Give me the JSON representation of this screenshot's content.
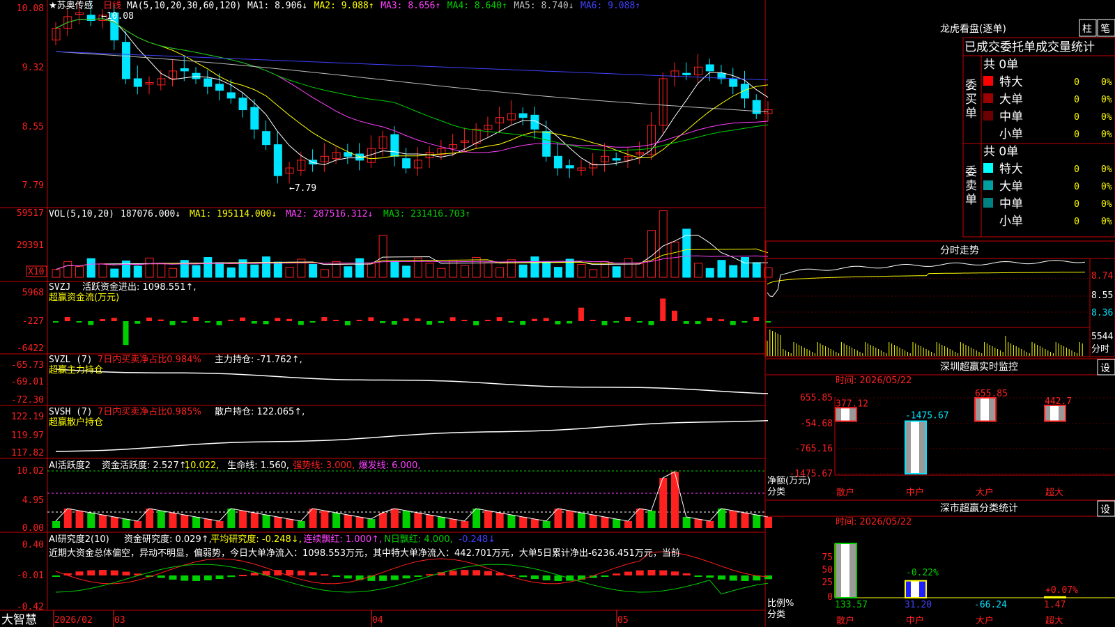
{
  "colors": {
    "up": "#ff2020",
    "down": "#00e5ff",
    "frame": "#c80000",
    "white": "#ffffff",
    "yellow": "#ffff00",
    "magenta": "#ff40ff",
    "green": "#00d000",
    "blue": "#4040ff",
    "gray": "#bdbdbd"
  },
  "stock": {
    "title": "★苏奥传感",
    "period": "日线"
  },
  "kline": {
    "ma_header": "MA(5,10,20,30,60,120)",
    "ma_items": [
      {
        "text": "MA1: 8.906↓",
        "color": "#ffffff"
      },
      {
        "text": "MA2: 9.088↑",
        "color": "#ffff00"
      },
      {
        "text": "MA3: 8.656↑",
        "color": "#ff40ff"
      },
      {
        "text": "MA4: 8.640↑",
        "color": "#00d000"
      },
      {
        "text": "MA5: 8.740↓",
        "color": "#bdbdbd"
      },
      {
        "text": "MA6: 9.088↑",
        "color": "#4040ff"
      }
    ],
    "y_ticks": [
      "10.08",
      "9.32",
      "8.55",
      "7.79"
    ],
    "high_label": "←10.08",
    "low_label": "←7.79"
  },
  "vol": {
    "title": "VOL(5,10,20)",
    "value": "187076.000↓",
    "ma1": "MA1: 195114.000↓",
    "ma2": "MA2: 287516.312↓",
    "ma3": "MA3: 231416.703↑",
    "y_ticks": [
      "59517",
      "29391"
    ],
    "multiplier": "X10"
  },
  "svzj": {
    "title": "SVZJ",
    "label1": "活跃资金进出: 1098.551↑,",
    "label2": "超赢资金流(万元)",
    "y_ticks": [
      "5968",
      "-227",
      "-6422"
    ]
  },
  "svzl": {
    "title": "SVZL (7)",
    "label_red": "7日内买卖净占比0.984%",
    "label_white": "主力持仓: -71.762↑,",
    "label2": "超赢主力持仓",
    "y_ticks": [
      "-65.73",
      "-69.01",
      "-72.30"
    ]
  },
  "svsh": {
    "title": "SVSH (7)",
    "label_red": "7日内买卖净占比0.985%",
    "label_white": "散户持仓: 122.065↑,",
    "label2": "超赢散户持仓",
    "y_ticks": [
      "122.19",
      "119.97",
      "117.82"
    ]
  },
  "ai1": {
    "title": "AI活跃度2",
    "items": [
      {
        "text": "资金活跃度: 2.527↑,",
        "color": "#ffffff"
      },
      {
        "text": "10.022,",
        "color": "#ffff00"
      },
      {
        "text": "生命线: 1.560,",
        "color": "#ffffff"
      },
      {
        "text": "强势线: 3.000,",
        "color": "#ff2020"
      },
      {
        "text": "爆发线: 6.000,",
        "color": "#ff40ff"
      }
    ],
    "y_ticks": [
      "10.02",
      "4.95",
      "0.00"
    ]
  },
  "ai2": {
    "title": "AI研究度2(10)",
    "items": [
      {
        "text": "资金研究度: 0.029↑,",
        "color": "#ffffff"
      },
      {
        "text": "平均研究度: -0.248↓,",
        "color": "#ffff00"
      },
      {
        "text": "连续飘红: 1.000↑,",
        "color": "#ff40ff"
      },
      {
        "text": "N日飘红: 4.000,",
        "color": "#00d000"
      },
      {
        "text": "-0.248↓",
        "color": "#4040ff"
      }
    ],
    "comment": "近期大资金总体偏空，异动不明显，偏弱势，今日大单净流入：1098.553万元，其中特大单净流入：442.701万元，大单5日累计净出-6236.451万元，当前",
    "y_ticks": [
      "0.40",
      "-0.01",
      "-0.42"
    ]
  },
  "xaxis": {
    "brand": "大智慧",
    "dates": [
      "2026/02",
      "03",
      "04",
      "05"
    ]
  },
  "longhu": {
    "title": "龙虎看盘(逐单)",
    "btn1": "柱",
    "btn2": "笔",
    "header": "已成交委托单成交量统计",
    "buy_label": "委买单",
    "sell_label": "委卖单",
    "buy_total": "共 0单",
    "sell_total": "共 0单",
    "buy_rows": [
      {
        "name": "特大",
        "value": "0",
        "pct": "0%",
        "swatch": "#ff0000"
      },
      {
        "name": "大单",
        "value": "0",
        "pct": "0%",
        "swatch": "#9c0000"
      },
      {
        "name": "中单",
        "value": "0",
        "pct": "0%",
        "swatch": "#6c0000"
      },
      {
        "name": "小单",
        "value": "0",
        "pct": "0%",
        "swatch": ""
      }
    ],
    "sell_rows": [
      {
        "name": "特大",
        "value": "0",
        "pct": "0%",
        "swatch": "#00ffff"
      },
      {
        "name": "大单",
        "value": "0",
        "pct": "0%",
        "swatch": "#00a0a0"
      },
      {
        "name": "中单",
        "value": "0",
        "pct": "0%",
        "swatch": "#008080"
      },
      {
        "name": "小单",
        "value": "0",
        "pct": "0%",
        "swatch": ""
      }
    ]
  },
  "fenshi": {
    "title": "分时走势",
    "y_ticks": [
      "8.74",
      "8.55",
      "8.36"
    ],
    "vol_tick": "5544",
    "vol_label": "分时"
  },
  "szmon": {
    "title": "深圳超赢实时监控",
    "btn": "设",
    "time": "时间: 2026/05/22",
    "y_ticks": [
      "655.85",
      "-54.68",
      "-765.16",
      "-1475.67"
    ],
    "ylabel1": "净额(万元)",
    "ylabel2": "分类",
    "bars": [
      {
        "label": "377.12",
        "value": 377.12,
        "cat": "散户"
      },
      {
        "label": "-1475.67",
        "value": -1475.67,
        "cat": "中户"
      },
      {
        "label": "655.85",
        "value": 655.85,
        "cat": "大户"
      },
      {
        "label": "442.7",
        "value": 442.7,
        "cat": "超大"
      }
    ]
  },
  "szcls": {
    "title": "深市超赢分类统计",
    "btn": "设",
    "time": "时间: 2026/05/22",
    "y_ticks": [
      "75",
      "50",
      "25",
      "0"
    ],
    "ylabel1": "比例%",
    "ylabel2": "分类",
    "bars": [
      {
        "pct": "",
        "value": 133.57,
        "cat": "散户",
        "bottom": "133.57"
      },
      {
        "pct": "-0.22%",
        "value": 31.2,
        "cat": "中户",
        "bottom": "31.20"
      },
      {
        "pct": "",
        "value": -66.24,
        "cat": "大户",
        "bottom": "-66.24"
      },
      {
        "pct": "+0.07%",
        "value": 1.47,
        "cat": "超大",
        "bottom": "1.47"
      }
    ]
  }
}
